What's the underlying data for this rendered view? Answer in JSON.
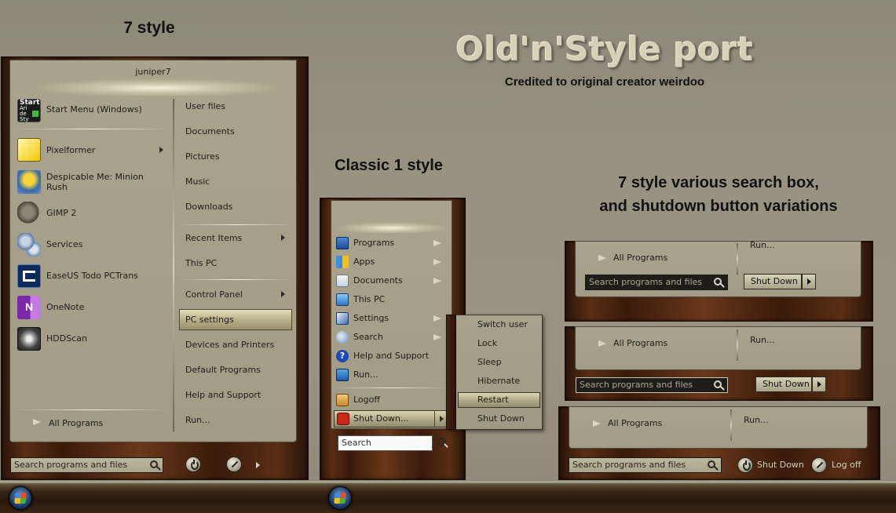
{
  "headings": {
    "seven_style": "7 style",
    "classic": "Classic 1 style",
    "title": "Old'n'Style port",
    "credit": "Credited to original creator weirdoo",
    "variations_line1": "7 style various search box,",
    "variations_line2": "and shutdown button variations"
  },
  "seven": {
    "username": "juniper7",
    "left_items": [
      {
        "label": "Start Menu (Windows)",
        "icon": "start-menu-icon"
      },
      {
        "label": "Pixelformer",
        "icon": "pixelformer-icon"
      },
      {
        "label": "Despicable Me: Minion",
        "label2": "Rush",
        "icon": "minion-icon"
      },
      {
        "label": "GIMP 2",
        "icon": "gimp-icon"
      },
      {
        "label": "Services",
        "icon": "gears-icon"
      },
      {
        "label": "EaseUS Todo PCTrans",
        "icon": "easeus-icon"
      },
      {
        "label": "OneNote",
        "icon": "onenote-icon"
      },
      {
        "label": "HDDScan",
        "icon": "hddscan-icon"
      }
    ],
    "start_icon_text": [
      "Start",
      "Ari",
      "de",
      "Sty"
    ],
    "all_programs": "All Programs",
    "right_items": [
      "User files",
      "Documents",
      "Pictures",
      "Music",
      "Downloads",
      "Recent Items",
      "This PC",
      "Control Panel",
      "PC settings",
      "Devices and Printers",
      "Default Programs",
      "Help and Support",
      "Run..."
    ],
    "search_placeholder": "Search programs and files"
  },
  "classic": {
    "items": [
      "Programs",
      "Apps",
      "Documents",
      "This PC",
      "Settings",
      "Search",
      "Help and Support",
      "Run...",
      "Logoff",
      "Shut Down..."
    ],
    "search_placeholder": "Search",
    "submenu": [
      "Switch user",
      "Lock",
      "Sleep",
      "Hibernate",
      "Restart",
      "Shut Down"
    ]
  },
  "variants": {
    "all_programs": "All Programs",
    "run": "Run...",
    "search_placeholder": "Search programs and files",
    "shut_down": "Shut Down",
    "log_off": "Log off"
  }
}
